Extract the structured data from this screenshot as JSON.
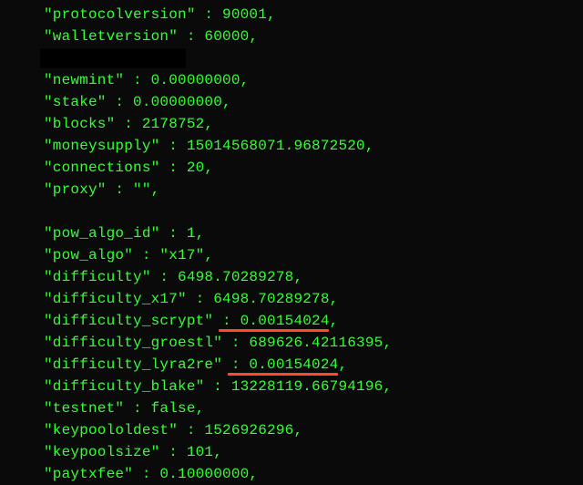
{
  "lines": [
    {
      "key": "protocolversion",
      "value": "90001"
    },
    {
      "key": "walletversion",
      "value": "60000"
    },
    {
      "redacted_full": true
    },
    {
      "key": "newmint",
      "value": "0.00000000"
    },
    {
      "key": "stake",
      "value": "0.00000000"
    },
    {
      "key": "blocks",
      "value": "2178752"
    },
    {
      "key": "moneysupply",
      "value": "15014568071.96872520"
    },
    {
      "key": "connections",
      "value": "20"
    },
    {
      "key": "proxy",
      "value": "\"\""
    },
    {
      "blank": true
    },
    {
      "key": "pow_algo_id",
      "value": "1"
    },
    {
      "key": "pow_algo",
      "value": "\"x17\"",
      "raw": true
    },
    {
      "key": "difficulty",
      "value": "6498.70289278"
    },
    {
      "key": "difficulty_x17",
      "value": "6498.70289278"
    },
    {
      "key": "difficulty_scrypt",
      "value": "0.00154024",
      "underline": true
    },
    {
      "key": "difficulty_groestl",
      "value": "689626.42116395"
    },
    {
      "key": "difficulty_lyra2re",
      "value": "0.00154024",
      "underline": true
    },
    {
      "key": "difficulty_blake",
      "value": "13228119.66794196"
    },
    {
      "key": "testnet",
      "value": "false"
    },
    {
      "key": "keypoololdest",
      "value": "1526926296"
    },
    {
      "key": "keypoolsize",
      "value": "101"
    },
    {
      "key": "paytxfee",
      "value": "0.10000000"
    }
  ],
  "colors": {
    "terminal_green": "#33ff33",
    "background": "#0a0a0a",
    "redaction": "#000000",
    "underline_highlight": "#ff4a2a"
  }
}
